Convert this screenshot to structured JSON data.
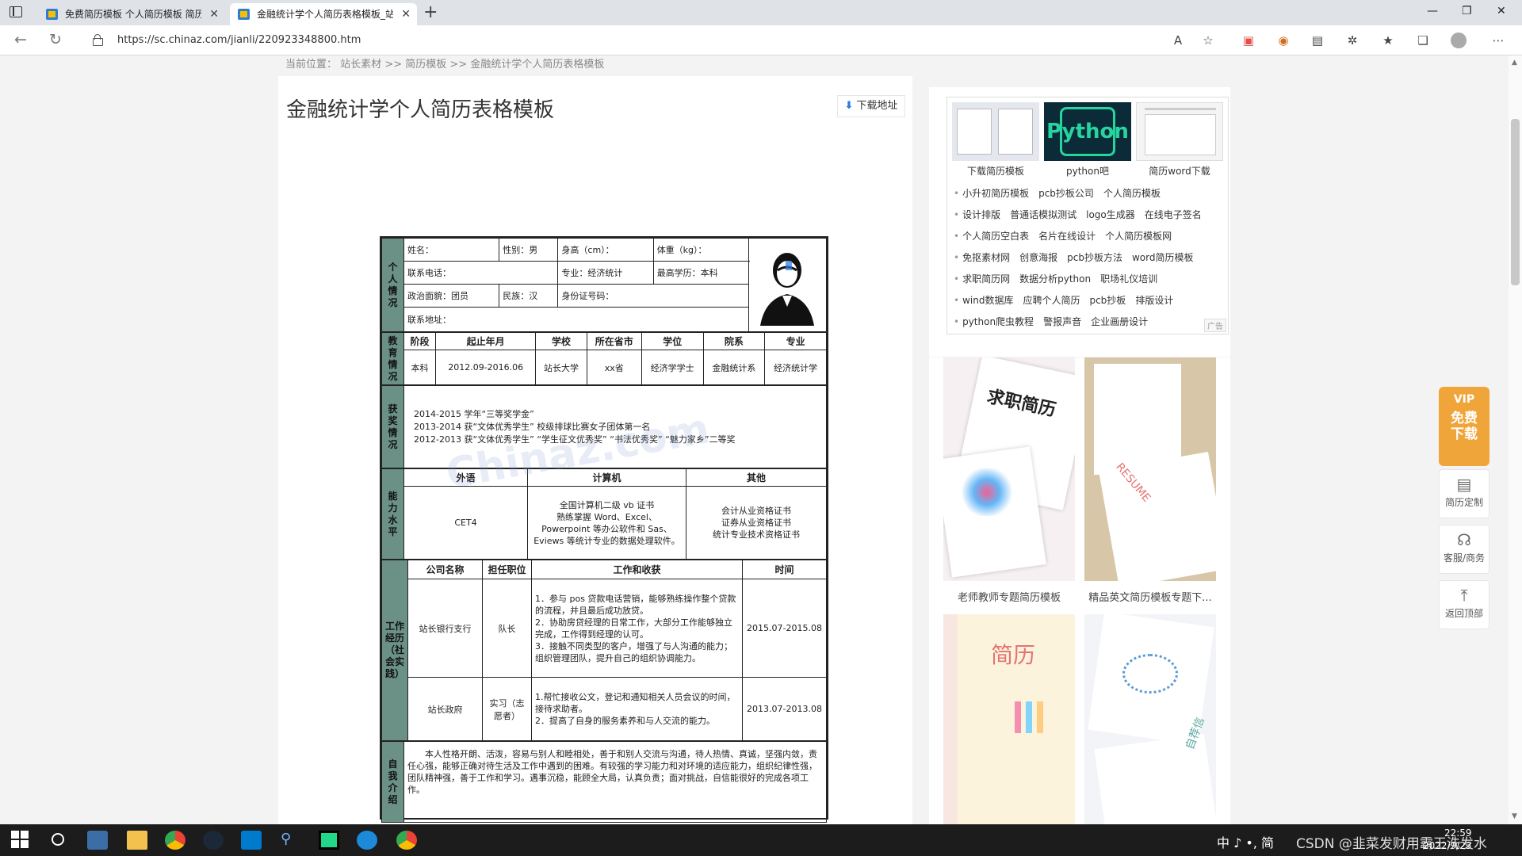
{
  "browser": {
    "tabs": [
      {
        "title": "免费简历模板 个人简历模板 简历"
      },
      {
        "title": "金融统计学个人简历表格模板_站"
      }
    ],
    "url": "https://sc.chinaz.com/jianli/220923348800.htm"
  },
  "breadcrumb": {
    "prefix": "当前位置：",
    "items": [
      "站长素材",
      "简历模板",
      "金融统计学个人简历表格模板"
    ],
    "sep": ">>"
  },
  "main": {
    "title": "金融统计学个人简历表格模板",
    "download_label": "下载地址"
  },
  "resume": {
    "sections": {
      "personal": "个人情况",
      "education": "教育情况",
      "awards": "获奖情况",
      "ability": "能力水平",
      "work": "工作经历（社会实践）",
      "self": "自我介绍"
    },
    "personal": {
      "name": "姓名：",
      "gender": "性别：男",
      "height": "身高（cm）：",
      "weight": "体重（kg）：",
      "phone": "联系电话：",
      "major": "专业：经济统计",
      "degree": "最高学历：本科",
      "political": "政治面貌：团员",
      "ethnic": "民族：汉",
      "idno": "身份证号码：",
      "address": "联系地址："
    },
    "education": {
      "headers": [
        "阶段",
        "起止年月",
        "学校",
        "所在省市",
        "学位",
        "院系",
        "专业"
      ],
      "row": [
        "本科",
        "2012.09-2016.06",
        "站长大学",
        "xx省",
        "经济学学士",
        "金融统计系",
        "经济统计学"
      ]
    },
    "awards": [
      "2014-2015 学年“三等奖学金”",
      "2013-2014 获“文体优秀学生”    校级排球比赛女子团体第一名",
      "2012-2013 获“文体优秀学生”  “学生征文优秀奖”  “书法优秀奖”  “魅力家乡”二等奖"
    ],
    "ability": {
      "headers": [
        "外语",
        "计算机",
        "其他"
      ],
      "foreign": "CET4",
      "computer": [
        "全国计算机二级 vb 证书",
        "熟练掌握 Word、Excel、",
        "Powerpoint 等办公软件和 Sas、",
        "Eviews 等统计专业的数据处理软件。"
      ],
      "other": [
        "会计从业资格证书",
        "证券从业资格证书",
        "统计专业技术资格证书"
      ]
    },
    "work": {
      "headers": [
        "公司名称",
        "担任职位",
        "工作和收获",
        "时间"
      ],
      "rows": [
        {
          "company": "站长银行支行",
          "position": "队长",
          "details": [
            "1．参与 pos 贷款电话营销，能够熟练操作整个贷款的流程，并且最后成功放贷。",
            "2．协助房贷经理的日常工作，大部分工作能够独立完成，工作得到经理的认可。",
            "3．接触不同类型的客户，增强了与人沟通的能力；组织管理团队，提升自己的组织协调能力。"
          ],
          "time": "2015.07-2015.08"
        },
        {
          "company": "站长政府",
          "position": "实习（志愿者）",
          "details": [
            "1.帮忙接收公文，登记和通知相关人员会议的时间，接待求助者。",
            "2．提高了自身的服务素养和与人交流的能力。"
          ],
          "time": "2013.07-2013.08"
        }
      ]
    },
    "self_intro": "本人性格开朗、活泼，容易与别人和睦相处，善于和别人交流与沟通，待人热情、真诚，坚强内敛，责任心强，能够正确对待生活及工作中遇到的困难。有较强的学习能力和对环境的适应能力，组织纪律性强，团队精神强，善于工作和学习。遇事沉稳，能顾全大局，认真负责；面对挑战，自信能很好的完成各项工作。",
    "watermark": "Chinaz.com"
  },
  "sidebar": {
    "ad_thumbs": [
      {
        "label": "下载简历模板"
      },
      {
        "label": "python吧",
        "art_text": "Python"
      },
      {
        "label": "简历word下载"
      }
    ],
    "keyword_rows": [
      [
        "小升初简历模板",
        "pcb抄板公司",
        "个人简历模板"
      ],
      [
        "设计排版",
        "普通话模拟测试",
        "logo生成器",
        "在线电子签名"
      ],
      [
        "个人简历空白表",
        "名片在线设计",
        "个人简历模板网"
      ],
      [
        "免抠素材网",
        "创意海报",
        "pcb抄板方法",
        "word简历模板"
      ],
      [
        "求职简历网",
        "数据分析python",
        "职场礼仪培训"
      ],
      [
        "wind数据库",
        "应聘个人简历",
        "pcb抄板",
        "排版设计"
      ],
      [
        "python爬虫教程",
        "警报声音",
        "企业画册设计"
      ]
    ],
    "ad_badge": "广告",
    "recommend": [
      {
        "label": "老师教师专题简历模板",
        "art_text": "求职简历"
      },
      {
        "label": "精品英文简历模板专题下...",
        "art_text": "RESUME"
      },
      {
        "label": "",
        "art_text": "简历"
      },
      {
        "label": "",
        "art_text": "自荐信"
      }
    ]
  },
  "float_tools": {
    "vip_top": "VIP",
    "vip_main": "免费下载",
    "buttons": [
      "简历定制",
      "客服/商务",
      "返回顶部"
    ]
  },
  "taskbar": {
    "tray_text": "中 ♪ •, 简",
    "time": "22:59",
    "date": "2022/9/23",
    "overlay": "CSDN @韭菜发财用霸王洗发水"
  },
  "colors": {
    "section_header": "#6b9187",
    "vip": "#f0a53a",
    "download_arrow": "#2a7bdc"
  }
}
